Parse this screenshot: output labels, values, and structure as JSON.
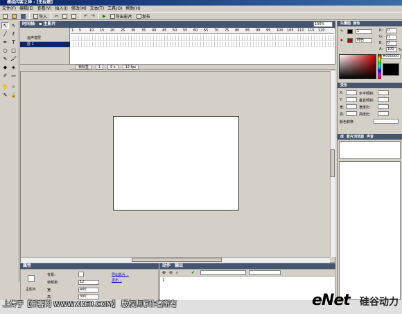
{
  "window": {
    "title": "模组闪客之神 - [无标题]"
  },
  "menu": [
    "文件(F)",
    "编辑(E)",
    "查看(V)",
    "插入(I)",
    "修改(M)",
    "文本(T)",
    "工具(O)",
    "帮助(H)"
  ],
  "toolbar": {
    "import_label": "导入",
    "export_label": "导出影片",
    "publish_label": "发布"
  },
  "tools": [
    "arrow",
    "subselect",
    "line",
    "lasso",
    "pen",
    "text",
    "oval",
    "rectangle",
    "pencil",
    "brush",
    "ink",
    "paint-bucket",
    "eyedropper",
    "eraser",
    "hand",
    "zoom",
    "stroke",
    "fill"
  ],
  "timeline": {
    "tab_label": "时间轴",
    "scene_label": "主影片",
    "zoom_value": "100%",
    "layers": [
      {
        "name": "运声音层"
      },
      {
        "name": "层 1"
      }
    ],
    "ruler": [
      "1",
      "5",
      "10",
      "15",
      "20",
      "25",
      "30",
      "35",
      "40",
      "45",
      "50",
      "55",
      "60",
      "65",
      "70",
      "75",
      "80",
      "85",
      "90",
      "95",
      "100",
      "105",
      "110",
      "115",
      "120"
    ],
    "status": {
      "frame_label": "帧标签",
      "frame": "1",
      "time": "0 s",
      "fps": "12 fps"
    }
  },
  "properties": {
    "header": "属性",
    "doc_label": "主影片",
    "background_label": "背景:",
    "framerate_label": "帧频率:",
    "framerate_value": "12",
    "width_label": "宽:",
    "width_value": "400",
    "height_label": "高:",
    "height_value": "300",
    "link_export": "导出影片...",
    "link_publish": "发布..."
  },
  "actions": {
    "tab_actions": "动作",
    "tab_output": "输出",
    "line_number": "1"
  },
  "right_panel": {
    "color_header": "矢量图",
    "color_tab2": "颜色",
    "r_label": "R:",
    "g_label": "G:",
    "b_label": "B:",
    "a_label": "A:",
    "r_value": "0",
    "g_value": "0",
    "b_value": "0",
    "a_value": "100",
    "pct": "%",
    "hex_value": "#000000",
    "fill_type": "纯色",
    "stroke_width": "1",
    "transform_header": "变形",
    "x_label": "X:",
    "y_label": "Y:",
    "hskew_label": "水平倾斜:",
    "vskew_label": "垂直倾斜:",
    "w_label": "宽:",
    "h_label": "高:",
    "wscale_label": "宽度比:",
    "hscale_label": "高度比:",
    "color_fx_label": "颜色转换",
    "library_tabs": [
      "库",
      "影片浏览器",
      "声音"
    ],
    "accent": "#44556f"
  },
  "banner": {
    "text": "上传于【新客网 WWW.XKER.COM】 版权归原作者所有",
    "watermark": "eNet",
    "watermark2": "硅谷动力"
  }
}
